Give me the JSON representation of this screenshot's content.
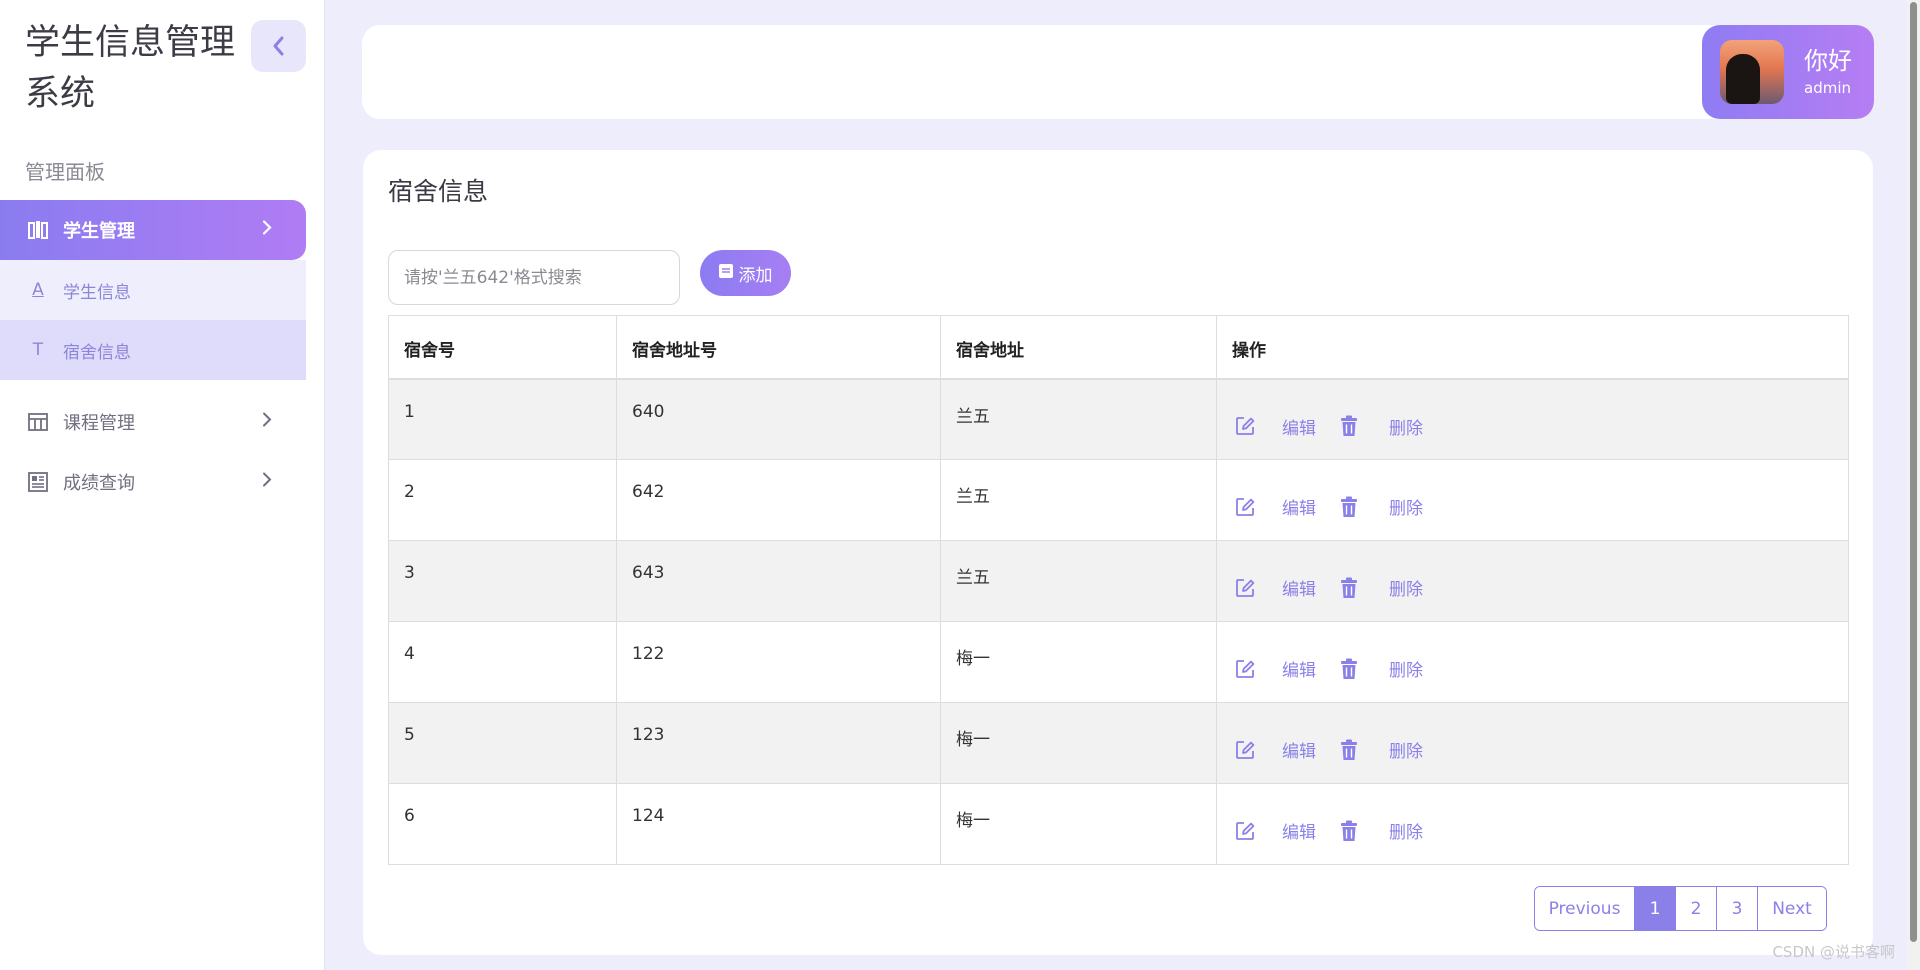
{
  "sidebar": {
    "title": "学生信息管理系统",
    "section_label": "管理面板",
    "items": [
      {
        "label": "学生管理",
        "icon": "book-columns-icon"
      },
      {
        "label": "课程管理",
        "icon": "table-icon"
      },
      {
        "label": "成绩查询",
        "icon": "newspaper-icon"
      }
    ],
    "subitems": [
      {
        "letter": "A",
        "label": "学生信息"
      },
      {
        "letter": "T",
        "label": "宿舍信息"
      }
    ]
  },
  "header": {
    "greeting": "你好",
    "username": "admin"
  },
  "main": {
    "title": "宿舍信息",
    "search_placeholder": "请按'兰五642'格式搜索",
    "add_label": "添加",
    "columns": [
      "宿舍号",
      "宿舍地址号",
      "宿舍地址",
      "操作"
    ],
    "rows": [
      {
        "id": "1",
        "number": "640",
        "address": "兰五"
      },
      {
        "id": "2",
        "number": "642",
        "address": "兰五"
      },
      {
        "id": "3",
        "number": "643",
        "address": "兰五"
      },
      {
        "id": "4",
        "number": "122",
        "address": "梅一"
      },
      {
        "id": "5",
        "number": "123",
        "address": "梅一"
      },
      {
        "id": "6",
        "number": "124",
        "address": "梅一"
      }
    ],
    "edit_label": "编辑",
    "delete_label": "删除"
  },
  "pagination": {
    "previous": "Previous",
    "pages": [
      "1",
      "2",
      "3"
    ],
    "current": "1",
    "next": "Next"
  },
  "watermark": "CSDN @说书客啊",
  "colors": {
    "accent": "#8a80e8",
    "gradient_start": "#8a7cf0",
    "gradient_end": "#b07cf4",
    "background": "#eeedfb"
  }
}
